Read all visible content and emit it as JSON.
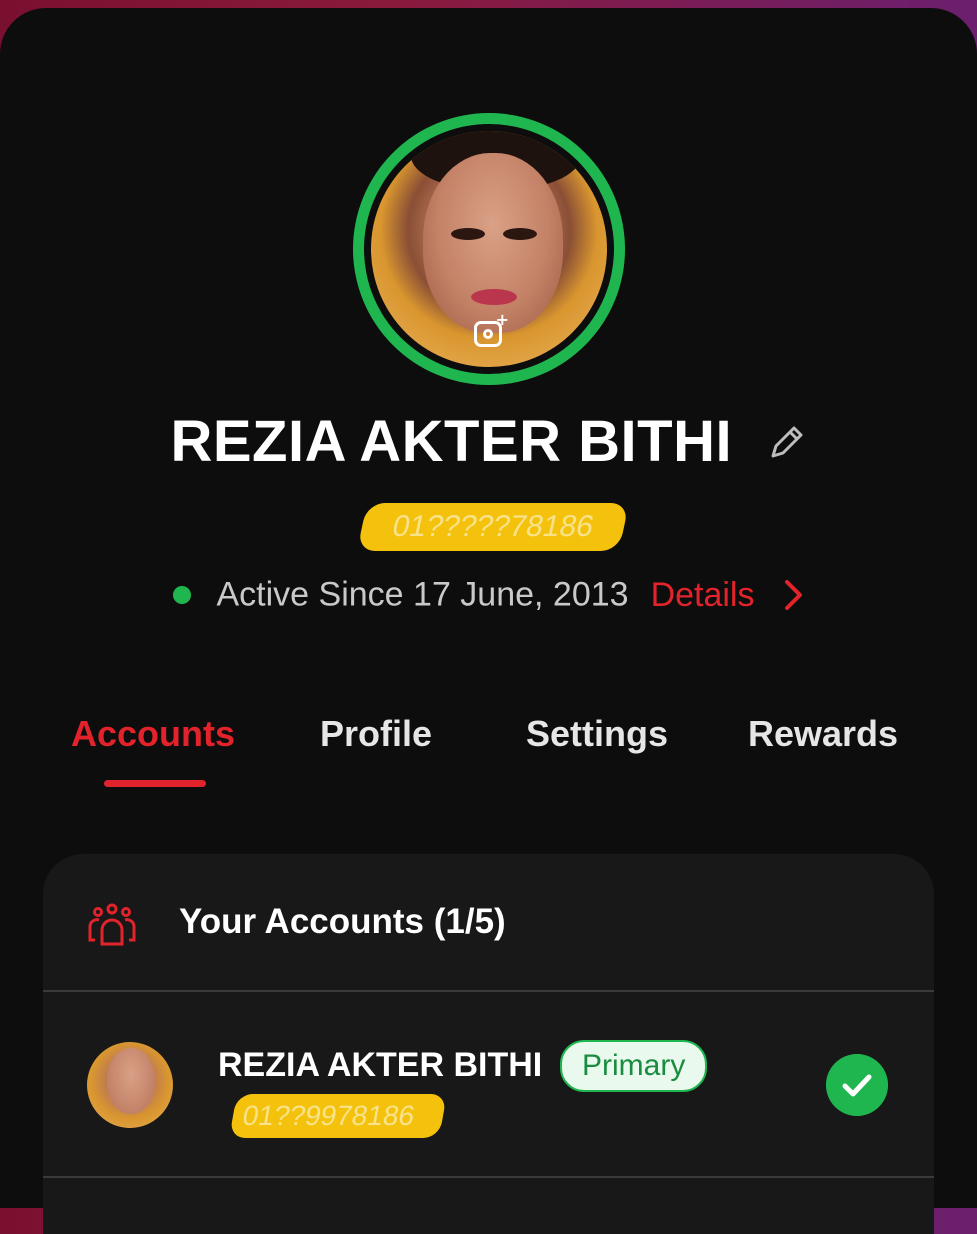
{
  "profile": {
    "name": "REZIA AKTER BITHI",
    "phone": "01?????78186",
    "status_text": "Active Since 17 June, 2013",
    "details_label": "Details"
  },
  "tabs": [
    {
      "label": "Accounts",
      "active": true
    },
    {
      "label": "Profile",
      "active": false
    },
    {
      "label": "Settings",
      "active": false
    },
    {
      "label": "Rewards",
      "active": false
    }
  ],
  "accounts_card": {
    "title": "Your Accounts (1/5)",
    "items": [
      {
        "name": "REZIA AKTER BITHI",
        "badge": "Primary",
        "phone": "01??9978186",
        "selected": true
      }
    ]
  },
  "colors": {
    "accent_red": "#e2232b",
    "status_green": "#1fb64f",
    "mask_yellow": "#f4c20d"
  },
  "icons": [
    "camera-add-icon",
    "pencil-edit-icon",
    "chevron-right-icon",
    "group-users-icon",
    "checkmark-icon"
  ]
}
